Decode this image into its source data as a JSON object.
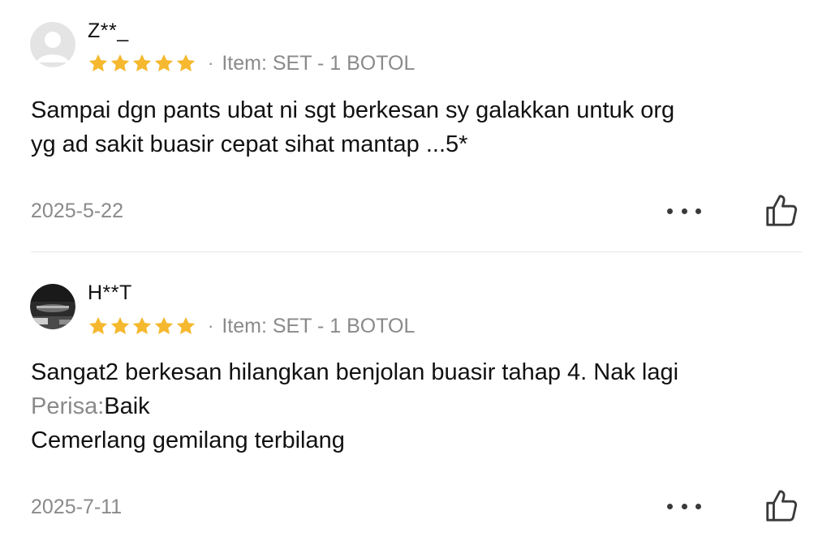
{
  "reviews": [
    {
      "username": "Z**_",
      "rating": 5,
      "separator": "·",
      "item_variant": "Item: SET - 1 BOTOL",
      "body_lines": [
        "Sampai dgn pants ubat ni sgt berkesan sy galakkan untuk org",
        "yg ad sakit buasir cepat sihat mantap ...5*"
      ],
      "date": "2025-5-22",
      "avatar": "default-user-avatar"
    },
    {
      "username": "H**T",
      "rating": 5,
      "separator": "·",
      "item_variant": "Item: SET - 1 BOTOL",
      "body_line_1": "Sangat2 berkesan hilangkan benjolan buasir tahap 4. Nak lagi",
      "attribute_label": "Perisa:",
      "attribute_value": "Baik",
      "body_line_3": "Cemerlang gemilang terbilang",
      "date": "2025-7-11",
      "avatar": "photo-avatar"
    }
  ],
  "colors": {
    "star": "#F5B82E",
    "muted_text": "#8A8A8A",
    "primary_text": "#111111",
    "divider": "#E6E6E6",
    "icon": "#3A3A3A"
  },
  "icons": {
    "more": "more-options-icon",
    "like": "thumbs-up-icon",
    "star": "star-icon"
  }
}
